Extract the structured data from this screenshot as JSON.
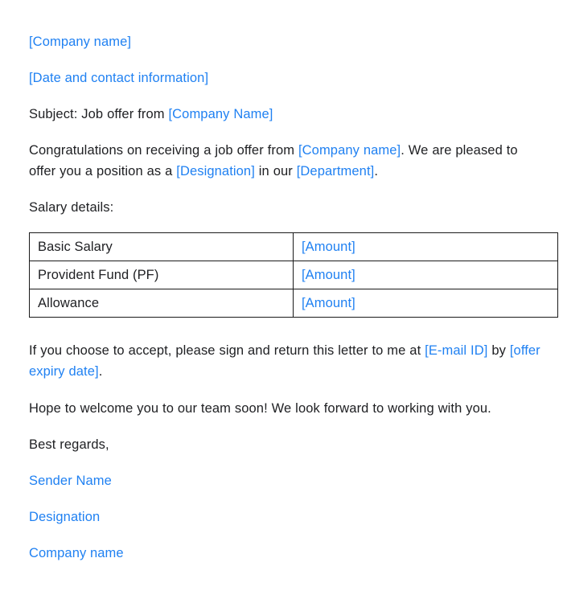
{
  "document": {
    "header": {
      "company_name_placeholder": "[Company name]",
      "date_contact_placeholder": "[Date and contact information]"
    },
    "subject": {
      "label": "Subject: Job offer from ",
      "company_placeholder": "[Company Name]"
    },
    "intro": {
      "part1": "Congratulations on receiving a job offer from ",
      "company_placeholder": "[Company name]",
      "part2": ". We are pleased to offer you a position as a ",
      "designation_placeholder": "[Designation]",
      "part3": " in our ",
      "department_placeholder": "[Department]",
      "part4": "."
    },
    "salary_section": {
      "heading": "Salary details:",
      "table": {
        "rows": [
          {
            "label": "Basic Salary",
            "value": "[Amount]"
          },
          {
            "label": "Provident Fund (PF)",
            "value": "[Amount]"
          },
          {
            "label": "Allowance",
            "value": "[Amount]"
          }
        ]
      }
    },
    "acceptance": {
      "part1": "If you choose to accept, please sign and return this letter to me at ",
      "email_placeholder": "[E-mail ID]",
      "part2": " by ",
      "expiry_placeholder": "[offer expiry date]",
      "part3": "."
    },
    "closing_line": "Hope to welcome you to our team soon! We look forward to working with you.",
    "signoff": "Best regards,",
    "signature": {
      "sender_name": "Sender Name",
      "designation": "Designation",
      "company_name": "Company name"
    }
  },
  "theme": {
    "placeholder_color": "#2081f2",
    "body_text_color": "#202124",
    "page_background": "#ffffff",
    "table_border_color": "#1a1a1a"
  }
}
